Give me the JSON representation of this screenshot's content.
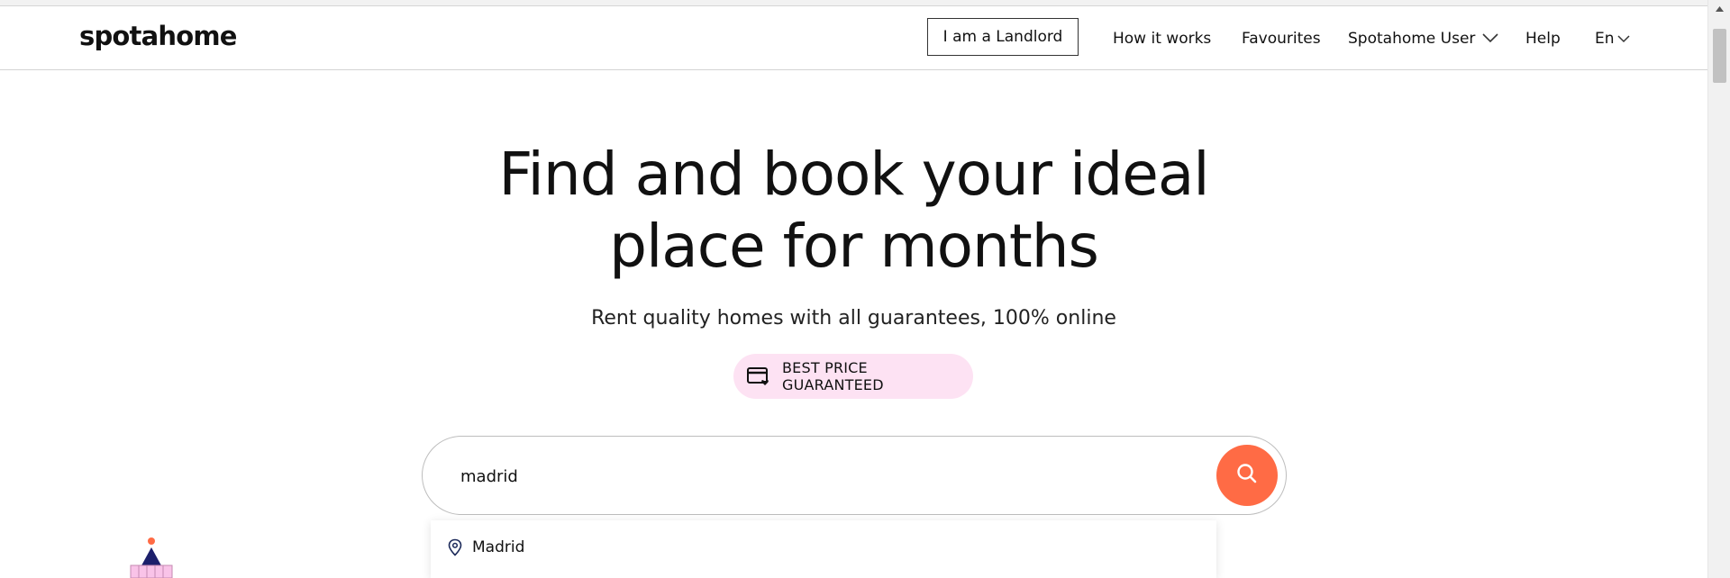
{
  "header": {
    "logo": "spotahome",
    "landlord_button": "I am a Landlord",
    "nav": {
      "how_it_works": "How it works",
      "favourites": "Favourites",
      "user_menu": "Spotahome User",
      "help": "Help",
      "language": "En"
    }
  },
  "hero": {
    "title_line1": "Find and book your ideal",
    "title_line2": "place for months",
    "subtitle": "Rent quality homes with all guarantees, 100% online",
    "badge": "BEST PRICE GUARANTEED"
  },
  "search": {
    "value": "madrid",
    "suggestions": [
      {
        "label": "Madrid",
        "icon": "location-pin-icon"
      }
    ]
  },
  "colors": {
    "accent": "#ff6b45",
    "badge_bg": "#fde2f3",
    "text": "#111111"
  }
}
